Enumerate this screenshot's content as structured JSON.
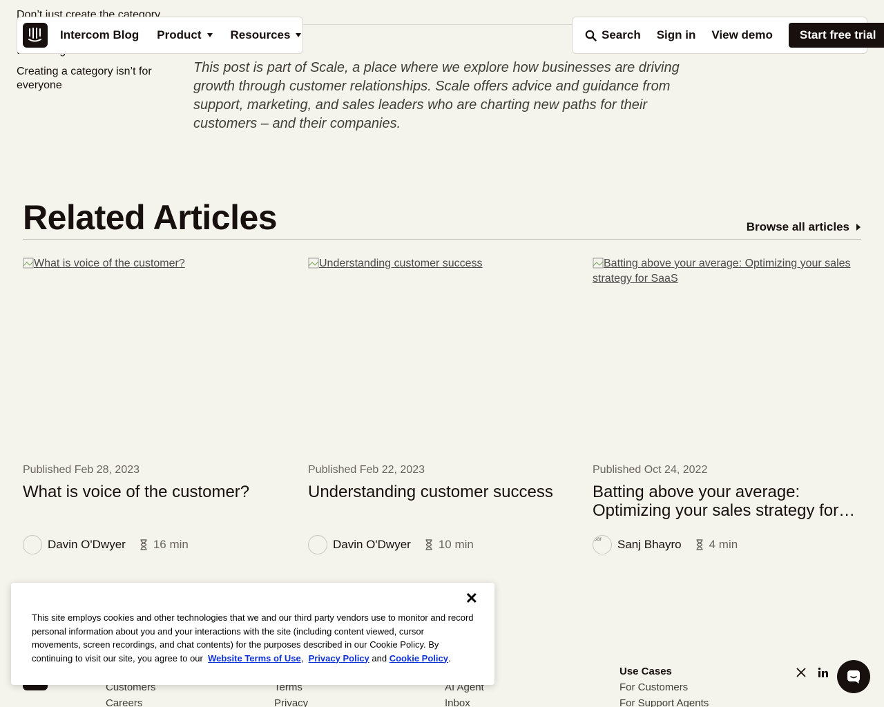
{
  "toc": {
    "items": [
      "Don’t just create the category",
      "their budgets",
      "Creating a category isn’t for everyone"
    ],
    "partial_prefix": "("
  },
  "header": {
    "brand": "Intercom Blog",
    "menus": [
      "Product",
      "Resources"
    ],
    "search_label": "Search",
    "signin_label": "Sign in",
    "demo_label": "View demo",
    "trial_label": "Start free trial"
  },
  "intro": {
    "text": "This post is part of Scale, a place where we explore how businesses are driving growth through customer relationships. Scale offers advice and guidance from support, marketing, and sales leaders who are charting new paths for their customers – and their companies."
  },
  "related": {
    "title": "Related Articles",
    "browse_label": "Browse all articles",
    "articles": [
      {
        "image_alt": "What is voice of the customer?",
        "published": "Published Feb 28, 2023",
        "title": "What is voice of the customer?",
        "author": "Davin O'Dwyer",
        "read_time": "16 min"
      },
      {
        "image_alt": "Understanding customer success",
        "published": "Published Feb 22, 2023",
        "title": "Understanding customer success",
        "author": "Davin O'Dwyer",
        "read_time": "10 min"
      },
      {
        "image_alt": "Batting above your average: Optimizing your sales strategy for SaaS",
        "published": "Published Oct 24, 2022",
        "title": "Batting above your average: Optimizing your sales strategy for…",
        "author": "Sanj Bhayro",
        "read_time": "4 min",
        "avatar_alt": "Sar"
      }
    ]
  },
  "footer": {
    "col1": [
      "Customers",
      "Careers"
    ],
    "col2": [
      "Terms",
      "Privacy"
    ],
    "col3": [
      "AI Agent",
      "Inbox"
    ],
    "col4_heading": "Use Cases",
    "col4": [
      "For Customers",
      "For Support Agents"
    ]
  },
  "cookie": {
    "text": "This site employs cookies and other technologies that we and our third party vendors use to monitor and record personal information about you and your interactions with the site (including content viewed, cursor movements, screen recordings, and chat contents) for the purposes described in our Cookie Policy. By continuing to visit our site, you agree to our",
    "terms_link": "Website Terms of Use",
    "sep1": ",",
    "privacy_link": "Privacy Policy",
    "and": "and",
    "cookie_link": "Cookie Policy",
    "end": ".",
    "close": "✕"
  }
}
